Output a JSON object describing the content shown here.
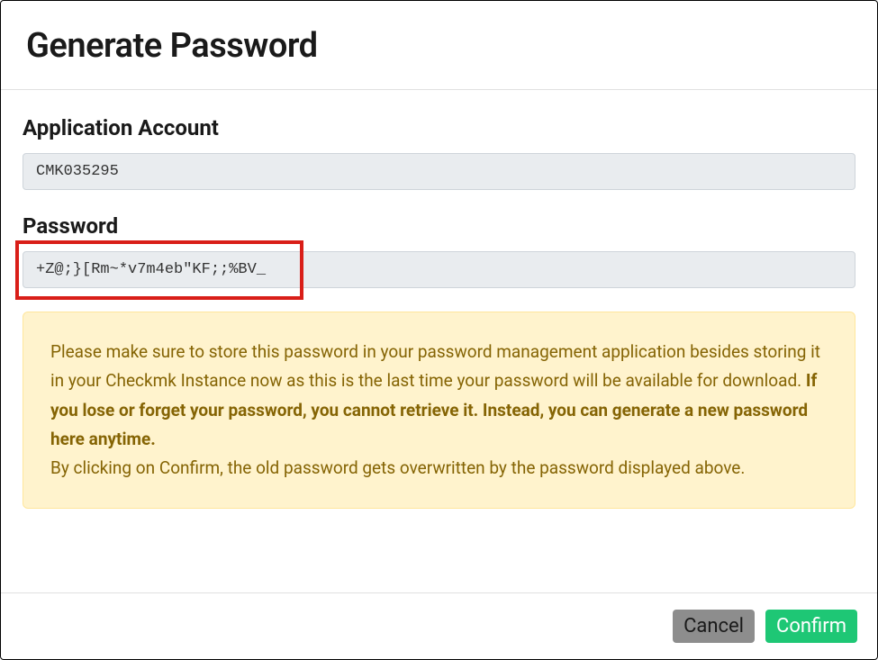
{
  "modal": {
    "title": "Generate Password"
  },
  "fields": {
    "account_label": "Application Account",
    "account_value": "CMK035295",
    "password_label": "Password",
    "password_value": "+Z@;}[Rm~*v7m4eb\"KF;;%BV_"
  },
  "alert": {
    "text_before_bold": "Please make sure to store this password in your password management application besides storing it in your Checkmk Instance now as this is the last time your password will be available for download. ",
    "text_bold": "If you lose or forget your password, you cannot retrieve it. Instead, you can generate a new password here anytime.",
    "text_after_bold": "By clicking on Confirm, the old password gets overwritten by the password displayed above."
  },
  "buttons": {
    "cancel_label": "Cancel",
    "confirm_label": "Confirm"
  }
}
